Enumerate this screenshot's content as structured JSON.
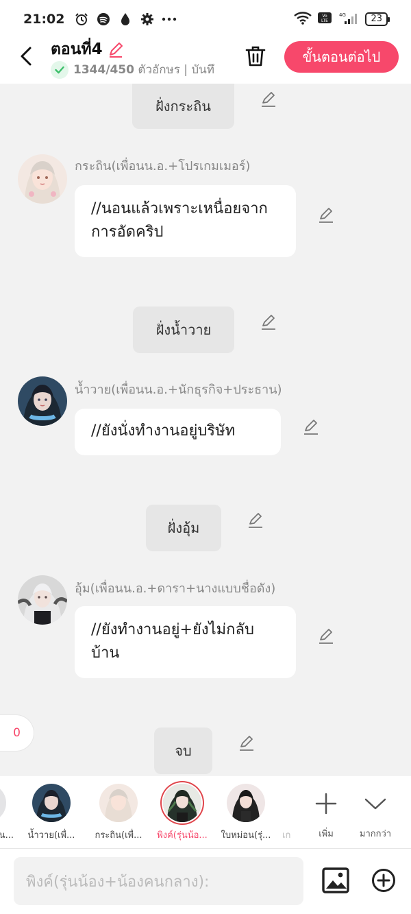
{
  "status_bar": {
    "time": "21:02",
    "battery": "23"
  },
  "header": {
    "title": "ตอนที่4",
    "char_count": "1344/450",
    "char_count_suffix": " ตัวอักษร | บันทึ",
    "next_label": "ขั้นตอนต่อไป"
  },
  "chat": {
    "scene1": "ฝั่งกระถิน",
    "msg1_name": "กระถิน(เพื่อนน.อ.+โปรเกมเมอร์)",
    "msg1_text": "//นอนแล้วเพราะเหนื่อยจากการอัดคริป",
    "scene2": "ฝั่งน้ำวาย",
    "msg2_name": "น้ำวาย(เพื่อนน.อ.+นักธุรกิจ+ประธาน)",
    "msg2_text": "//ยังนั่งทำงานอยู่บริษัท",
    "scene3": "ฝั่งอุ้ม",
    "msg3_name": "อุ้ม(เพื่อนน.อ.+ดารา+นางแบบชื่อดัง)",
    "msg3_text": "//ยังทำงานอยู่+ยังไม่กลับบ้าน",
    "scene4": "จบ",
    "counter": "0"
  },
  "char_bar": {
    "items": [
      {
        "label": "น..."
      },
      {
        "label": "น้ำวาย(เพื่..."
      },
      {
        "label": "กระถิน(เพื่..."
      },
      {
        "label": "พิงค์(รุ่นน้อ..."
      },
      {
        "label": "ใบหม่อน(รุ่..."
      },
      {
        "label": "เก"
      }
    ],
    "add_label": "เพิ่ม",
    "more_label": "มากกว่า"
  },
  "input": {
    "placeholder": "พิงค์(รุ่นน้อง+น้องคนกลาง):"
  },
  "colors": {
    "accent": "#f7486b",
    "bg": "#f2f2f2",
    "chip": "#e6e6e6"
  },
  "icons": [
    "alarm-icon",
    "spotify-icon",
    "drop-icon",
    "gear-icon",
    "more-icon",
    "wifi-icon",
    "volte-icon",
    "signal-icon",
    "battery-icon",
    "back-icon",
    "pen-icon",
    "check-icon",
    "trash-icon",
    "plus-icon",
    "chevron-down-icon",
    "image-icon",
    "add-circle-icon"
  ]
}
